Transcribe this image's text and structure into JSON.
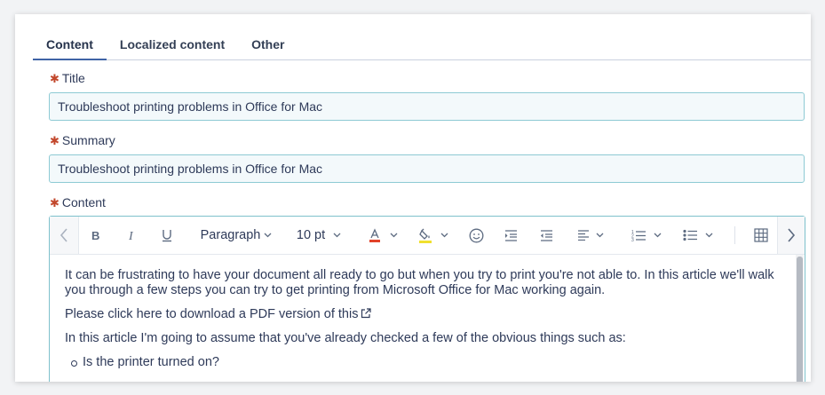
{
  "tabs": [
    {
      "label": "Content",
      "active": true
    },
    {
      "label": "Localized content",
      "active": false
    },
    {
      "label": "Other",
      "active": false
    }
  ],
  "required_marker": "✱",
  "fields": {
    "title": {
      "label": "Title",
      "value": "Troubleshoot printing problems in Office for Mac"
    },
    "summary": {
      "label": "Summary",
      "value": "Troubleshoot printing problems in Office for Mac"
    },
    "content": {
      "label": "Content"
    }
  },
  "toolbar": {
    "block_format": "Paragraph",
    "font_size": "10 pt",
    "font_color": "#e2432a",
    "highlight_color": "#f0e02e",
    "icons": [
      "chevron-left-icon",
      "bold-icon",
      "italic-icon",
      "underline-icon",
      "font-color-icon",
      "highlight-icon",
      "emoji-icon",
      "indent-icon",
      "outdent-icon",
      "align-left-icon",
      "numbered-list-icon",
      "bulleted-list-icon",
      "table-icon",
      "chevron-right-icon"
    ]
  },
  "editor_body": {
    "paragraph1": "It can be frustrating to have your document all ready to go but when you try to print you're not able to. In this article we'll walk you through a few steps you can try to get printing from Microsoft Office for Mac working again.",
    "link_text": "Please click here to download a PDF version of this",
    "paragraph2": "In this article I'm going to assume that you've already checked a few of the obvious things such as:",
    "list_items": [
      "Is the printer turned on?"
    ]
  },
  "colors": {
    "accent": "#3f63a6",
    "required": "#c2472c",
    "input_border": "#8dcad4",
    "input_bg": "#f3f9fb"
  }
}
